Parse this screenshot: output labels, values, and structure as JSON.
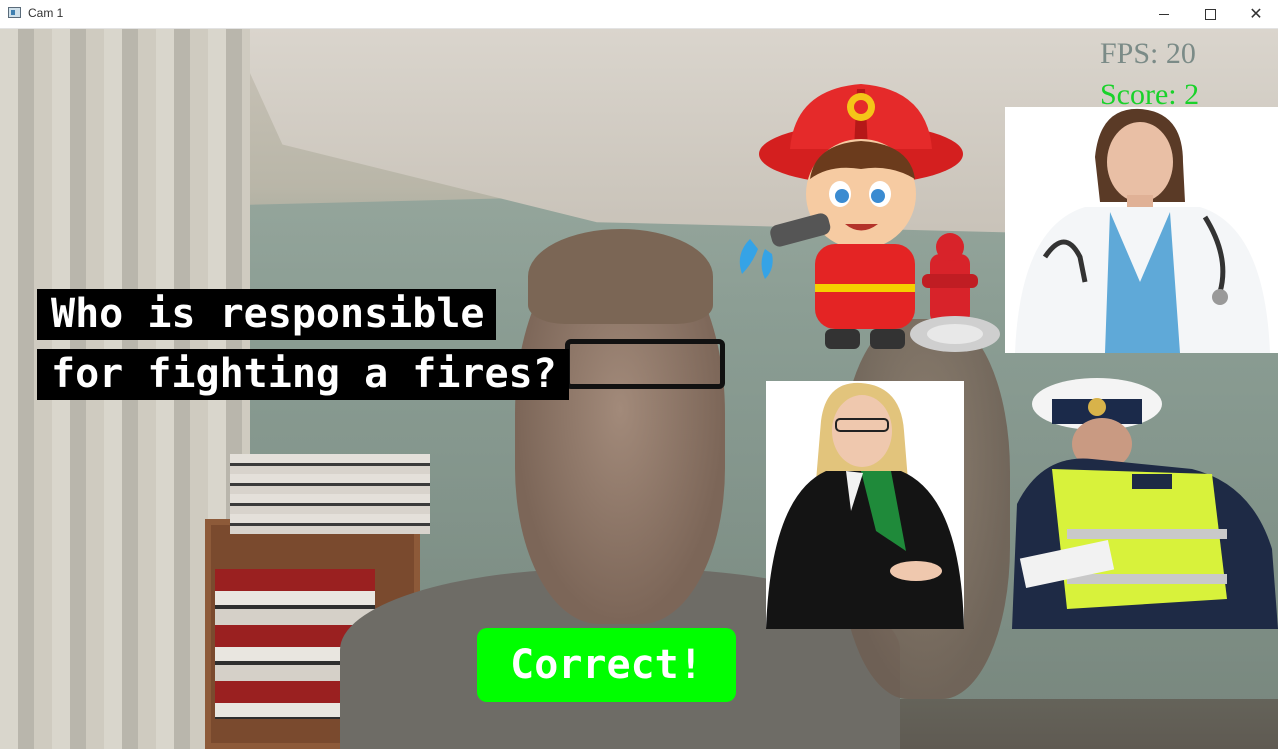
{
  "window": {
    "title": "Cam 1",
    "controls": {
      "minimize": "minimize-icon",
      "maximize": "maximize-icon",
      "close": "✕"
    }
  },
  "hud": {
    "fps": "FPS: 20",
    "score": "Score: 2"
  },
  "question": {
    "line1": "Who is responsible",
    "line2": "for fighting a fires?"
  },
  "answers": [
    {
      "id": "firefighter",
      "icon": "firefighter-cartoon-image"
    },
    {
      "id": "doctor",
      "icon": "doctor-photo"
    },
    {
      "id": "lawyer",
      "icon": "lawyer-photo"
    },
    {
      "id": "police",
      "icon": "police-officer-photo"
    }
  ],
  "result": {
    "text": "Correct!",
    "color": "#00ff00"
  },
  "colors": {
    "score": "#19d22a",
    "fps": "#7b8b87",
    "question_bg": "#000000",
    "question_text": "#ffffff"
  }
}
